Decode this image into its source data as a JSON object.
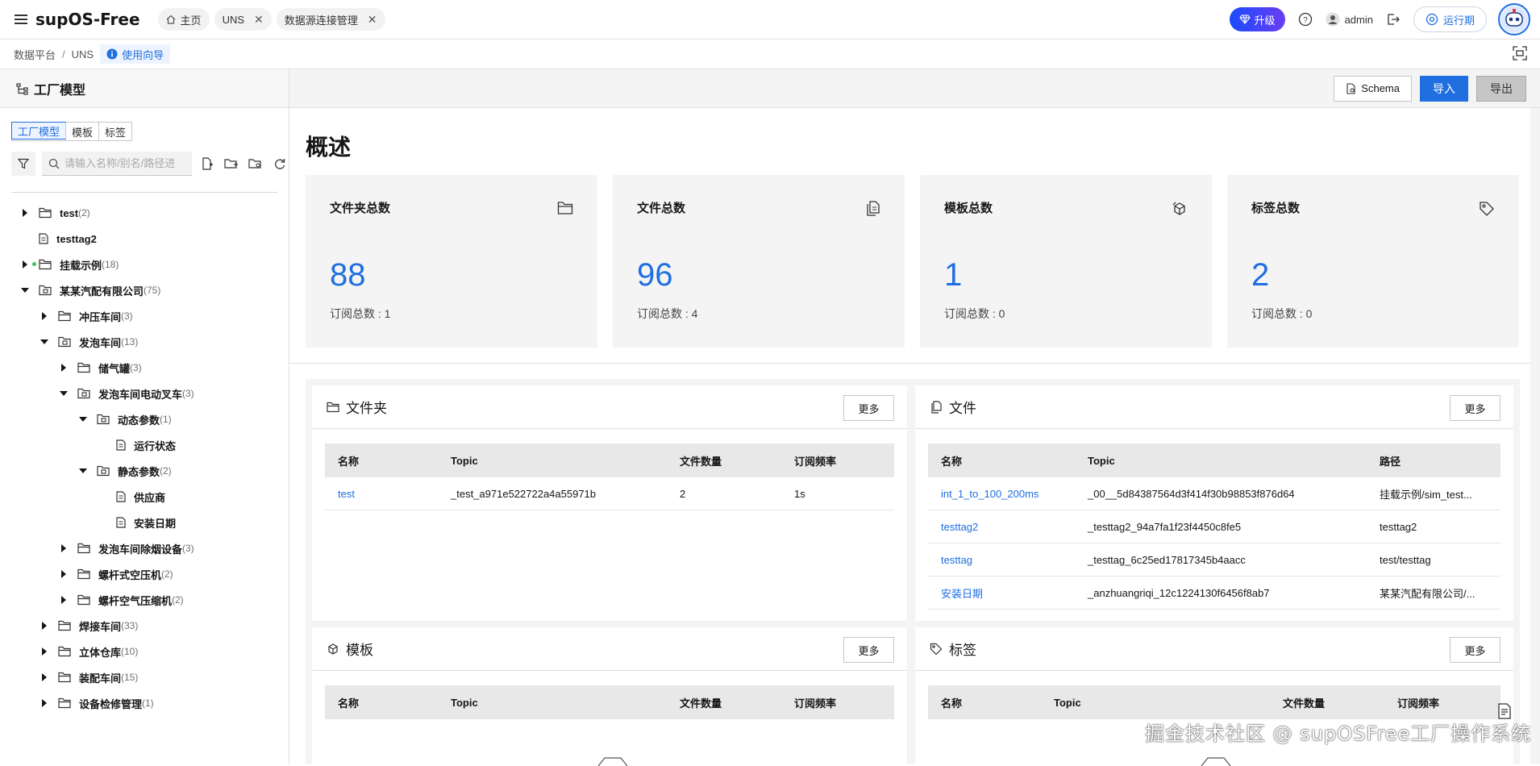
{
  "app": {
    "title": "supOS-Free"
  },
  "tabs": [
    {
      "label": "主页",
      "closable": false
    },
    {
      "label": "UNS",
      "closable": true
    },
    {
      "label": "数据源连接管理",
      "closable": true
    }
  ],
  "topbar": {
    "upgrade": "升级",
    "user": "admin",
    "runtime": "运行期"
  },
  "breadcrumb": {
    "items": [
      "数据平台",
      "UNS"
    ],
    "guide": "使用向导"
  },
  "left": {
    "title": "工厂模型",
    "segments": [
      "工厂模型",
      "模板",
      "标签"
    ],
    "search_placeholder": "请输入名称/别名/路径进",
    "tree": [
      {
        "label": "test",
        "count": "(2)"
      },
      {
        "label": "testtag2",
        "count": ""
      },
      {
        "label": "挂载示例",
        "count": "(18)"
      },
      {
        "label": "某某汽配有限公司",
        "count": "(75)"
      },
      {
        "label": "冲压车间",
        "count": "(3)"
      },
      {
        "label": "发泡车间",
        "count": "(13)"
      },
      {
        "label": "储气罐",
        "count": "(3)"
      },
      {
        "label": "发泡车间电动叉车",
        "count": "(3)"
      },
      {
        "label": "动态参数",
        "count": "(1)"
      },
      {
        "label": "运行状态",
        "count": ""
      },
      {
        "label": "静态参数",
        "count": "(2)"
      },
      {
        "label": "供应商",
        "count": ""
      },
      {
        "label": "安装日期",
        "count": ""
      },
      {
        "label": "发泡车间除烟设备",
        "count": "(3)"
      },
      {
        "label": "螺杆式空压机",
        "count": "(2)"
      },
      {
        "label": "螺杆空气压缩机",
        "count": "(2)"
      },
      {
        "label": "焊接车间",
        "count": "(33)"
      },
      {
        "label": "立体仓库",
        "count": "(10)"
      },
      {
        "label": "装配车间",
        "count": "(15)"
      },
      {
        "label": "设备检修管理",
        "count": "(1)"
      }
    ]
  },
  "main": {
    "actions": {
      "schema": "Schema",
      "import": "导入",
      "export": "导出"
    },
    "overview_title": "概述",
    "cards": [
      {
        "title": "文件夹总数",
        "value": "88",
        "sub": "订阅总数 : 1",
        "icon": "folder-icon"
      },
      {
        "title": "文件总数",
        "value": "96",
        "sub": "订阅总数 : 4",
        "icon": "files-icon"
      },
      {
        "title": "模板总数",
        "value": "1",
        "sub": "订阅总数 : 0",
        "icon": "cube-icon"
      },
      {
        "title": "标签总数",
        "value": "2",
        "sub": "订阅总数 : 0",
        "icon": "tag-icon"
      }
    ],
    "more": "更多",
    "folders": {
      "title": "文件夹",
      "columns": [
        "名称",
        "Topic",
        "文件数量",
        "订阅频率"
      ],
      "rows": [
        [
          "test",
          "_test_a971e522722a4a55971b",
          "2",
          "1s"
        ]
      ]
    },
    "files": {
      "title": "文件",
      "columns": [
        "名称",
        "Topic",
        "路径"
      ],
      "rows": [
        [
          "int_1_to_100_200ms",
          "_00__5d84387564d3f414f30b98853f876d64",
          "挂载示例/sim_test..."
        ],
        [
          "testtag2",
          "_testtag2_94a7fa1f23f4450c8fe5",
          "testtag2"
        ],
        [
          "testtag",
          "_testtag_6c25ed17817345b4aacc",
          "test/testtag"
        ],
        [
          "安装日期",
          "_anzhuangriqi_12c1224130f6456f8ab7",
          "某某汽配有限公司/..."
        ]
      ]
    },
    "templates": {
      "title": "模板",
      "columns": [
        "名称",
        "Topic",
        "文件数量",
        "订阅频率"
      ]
    },
    "labels": {
      "title": "标签",
      "columns": [
        "名称",
        "Topic",
        "文件数量",
        "订阅频率"
      ]
    }
  },
  "watermark": "掘金技术社区 @ supOSFree工厂操作系统",
  "colors": {
    "accent": "#1f6fe0",
    "upgrade_start": "#1a4bff",
    "upgrade_end": "#6a3df2"
  }
}
